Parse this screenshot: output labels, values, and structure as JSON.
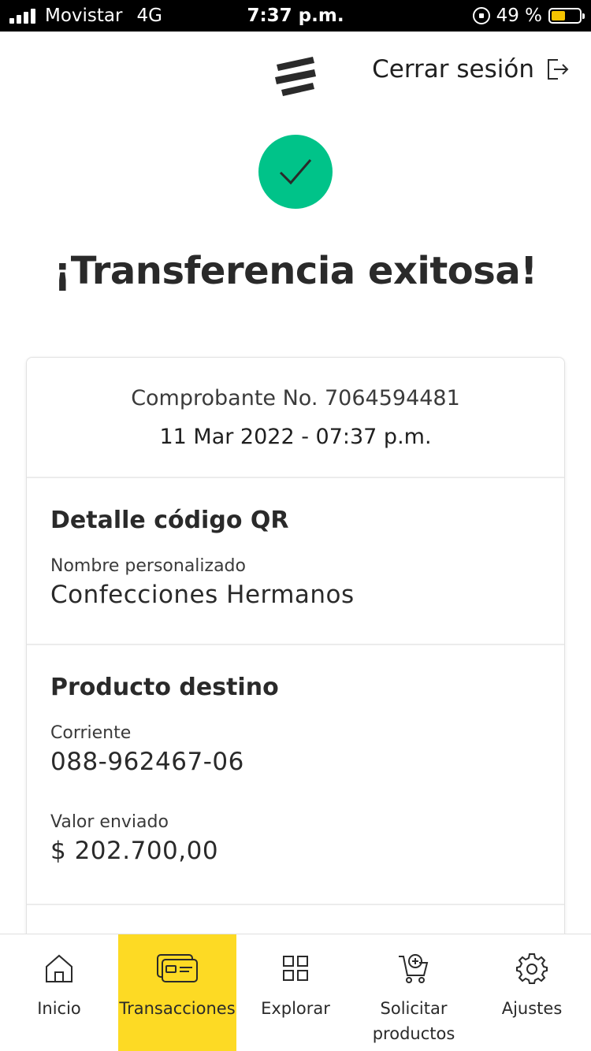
{
  "status_bar": {
    "carrier": "Movistar",
    "network": "4G",
    "time": "7:37 p.m.",
    "battery_percent": "49 %",
    "battery_level": 0.49,
    "battery_color": "#f5c400"
  },
  "header": {
    "logout_label": "Cerrar sesión",
    "logout_icon": "logout-icon",
    "logo_icon": "bank-logo"
  },
  "success": {
    "icon": "check-icon",
    "color": "#00c389",
    "title": "¡Transferencia exitosa!"
  },
  "receipt": {
    "number": "Comprobante No. 7064594481",
    "date": "11 Mar 2022 - 07:37 p.m."
  },
  "qr_detail": {
    "heading": "Detalle código QR",
    "name_label": "Nombre personalizado",
    "name_value": "Confecciones Hermanos"
  },
  "destination": {
    "heading": "Producto destino",
    "account_type": "Corriente",
    "account_number": "088-962467-06",
    "amount_label": "Valor enviado",
    "amount_value": "$ 202.700,00"
  },
  "nav": {
    "accent": "#fdda24",
    "items": [
      {
        "label": "Inicio",
        "icon": "home-icon"
      },
      {
        "label": "Transacciones",
        "icon": "cards-icon",
        "active": true
      },
      {
        "label": "Explorar",
        "icon": "grid-icon"
      },
      {
        "label": "Solicitar productos",
        "icon": "cart-add-icon"
      },
      {
        "label": "Ajustes",
        "icon": "gear-icon"
      }
    ]
  }
}
